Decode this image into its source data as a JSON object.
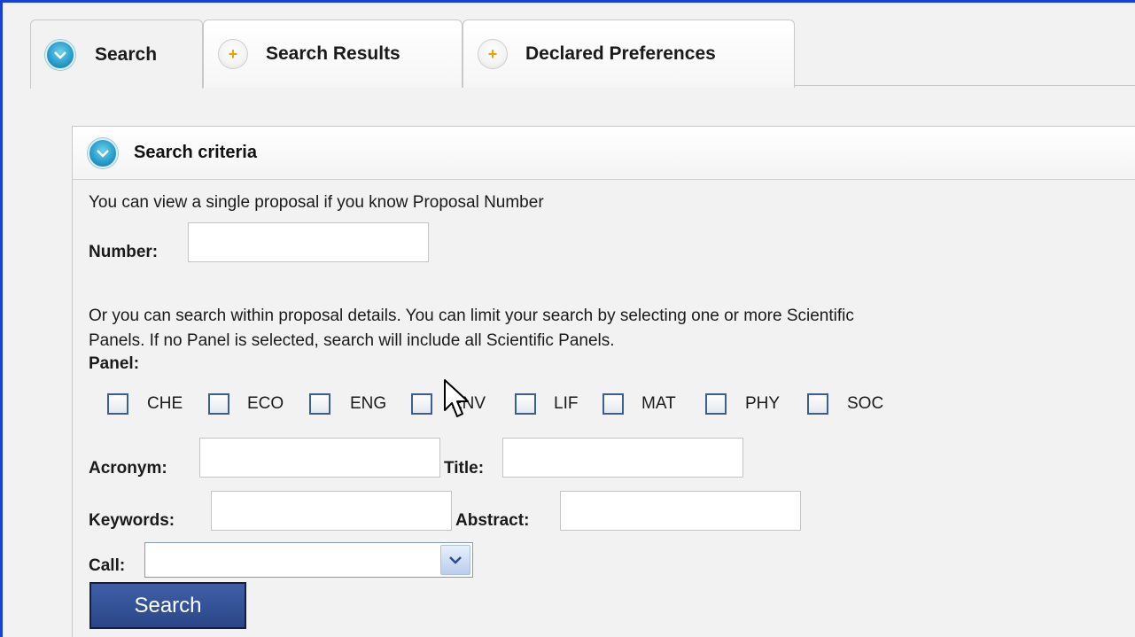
{
  "tabs": [
    {
      "label": "Search",
      "icon": "collapse-circle-icon",
      "active": true
    },
    {
      "label": "Search Results",
      "icon": "expand-plus-icon",
      "active": false
    },
    {
      "label": "Declared Preferences",
      "icon": "expand-plus-icon",
      "active": false
    }
  ],
  "panel": {
    "title": "Search criteria",
    "intro": "You can view a single proposal if you know Proposal Number",
    "number_label": "Number:",
    "number_value": "",
    "details_text_1": "Or you can search within proposal details. You can limit your search by selecting one or more Scientific",
    "details_text_2": "Panels. If no Panel is selected, search will include all Scientific Panels.",
    "panel_label": "Panel:",
    "panels": [
      {
        "code": "CHE",
        "checked": false
      },
      {
        "code": "ECO",
        "checked": false
      },
      {
        "code": "ENG",
        "checked": false
      },
      {
        "code": "ENV",
        "checked": false
      },
      {
        "code": "LIF",
        "checked": false
      },
      {
        "code": "MAT",
        "checked": false
      },
      {
        "code": "PHY",
        "checked": false
      },
      {
        "code": "SOC",
        "checked": false
      }
    ],
    "acronym_label": "Acronym:",
    "acronym_value": "",
    "title_label": "Title:",
    "title_value": "",
    "keywords_label": "Keywords:",
    "keywords_value": "",
    "abstract_label": "Abstract:",
    "abstract_value": "",
    "call_label": "Call:",
    "call_selected": "",
    "search_button": "Search"
  },
  "colors": {
    "window_border": "#1a3fd6",
    "button_bg": "#2f4b8f",
    "checkbox_border": "#3b5f8f",
    "accent_plus": "#f0a000",
    "collapse_icon": "#2a9fcc"
  }
}
